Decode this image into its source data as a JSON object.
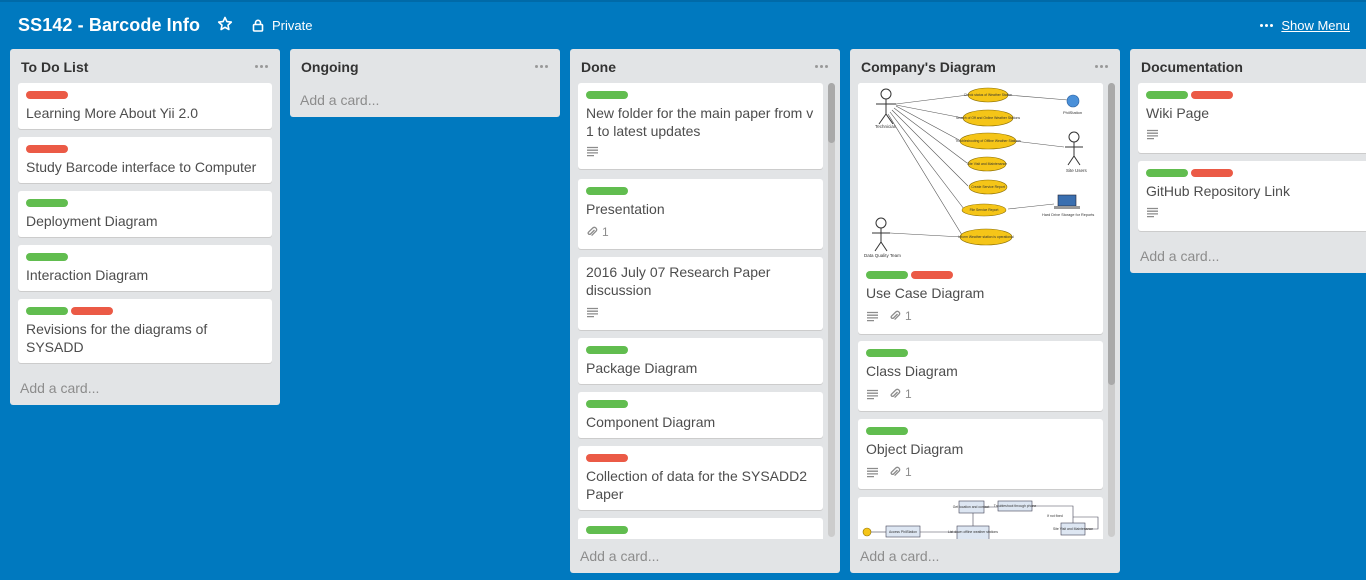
{
  "board": {
    "title": "SS142 - Barcode Info",
    "visibility": "Private",
    "show_menu": "Show Menu"
  },
  "lists": [
    {
      "title": "To Do List",
      "add_card": "Add a card...",
      "cards": [
        {
          "labels": [
            "red"
          ],
          "title": "Learning More About Yii 2.0"
        },
        {
          "labels": [
            "red"
          ],
          "title": "Study Barcode interface to Computer"
        },
        {
          "labels": [
            "green"
          ],
          "title": "Deployment Diagram"
        },
        {
          "labels": [
            "green"
          ],
          "title": "Interaction Diagram"
        },
        {
          "labels": [
            "green",
            "red"
          ],
          "title": "Revisions for the diagrams of SYSADD"
        }
      ]
    },
    {
      "title": "Ongoing",
      "add_card": "Add a card...",
      "cards": []
    },
    {
      "title": "Done",
      "add_card": "Add a card...",
      "cards": [
        {
          "labels": [
            "green"
          ],
          "title": "New folder for the main paper from v 1 to latest updates",
          "badges": {
            "description": true
          }
        },
        {
          "labels": [
            "green"
          ],
          "title": "Presentation",
          "badges": {
            "attachments": "1"
          }
        },
        {
          "labels": [],
          "title": "2016 July 07 Research Paper discussion",
          "badges": {
            "description": true
          }
        },
        {
          "labels": [
            "green"
          ],
          "title": "Package Diagram"
        },
        {
          "labels": [
            "green"
          ],
          "title": "Component Diagram"
        },
        {
          "labels": [
            "red"
          ],
          "title": "Collection of data for the SYSADD2 Paper"
        },
        {
          "labels": [
            "green"
          ],
          "title": ""
        }
      ]
    },
    {
      "title": "Company's Diagram",
      "add_card": "Add a card...",
      "cards": [
        {
          "labels": [
            "green",
            "red"
          ],
          "title": "Use Case Diagram",
          "badges": {
            "description": true,
            "attachments": "1"
          },
          "cover": {
            "actors": [
              "Technician",
              "Site Users",
              "Data Quality Team"
            ],
            "use_cases": [
              "Check status of Weather Station",
              "Search of Off and Online Weather Stations",
              "Troubleshooting of Offline Weather Stations",
              "Site Visit and Maintenance",
              "Create Service Report",
              "File Service Report",
              "Inform Weather station is operational"
            ],
            "systems": [
              "PhilStation",
              "Hard Drive Storage for Reports"
            ]
          }
        },
        {
          "labels": [
            "green"
          ],
          "title": "Class Diagram",
          "badges": {
            "description": true,
            "attachments": "1"
          }
        },
        {
          "labels": [
            "green"
          ],
          "title": "Object Diagram",
          "badges": {
            "description": true,
            "attachments": "1"
          }
        },
        {
          "labels": [],
          "title": "",
          "cover": {
            "boxes": [
              "Access PhilStation",
              "List down offline weather stations",
              "Get location and contact",
              "Troubleshoot through phone",
              "If not fixed",
              "Site Visit and Maintenance"
            ]
          }
        }
      ]
    },
    {
      "title": "Documentation",
      "add_card": "Add a card...",
      "cards": [
        {
          "labels": [
            "green",
            "red"
          ],
          "title": "Wiki Page",
          "badges": {
            "description": true
          }
        },
        {
          "labels": [
            "green",
            "red"
          ],
          "title": "GitHub Repository Link",
          "badges": {
            "description": true
          }
        }
      ]
    }
  ]
}
